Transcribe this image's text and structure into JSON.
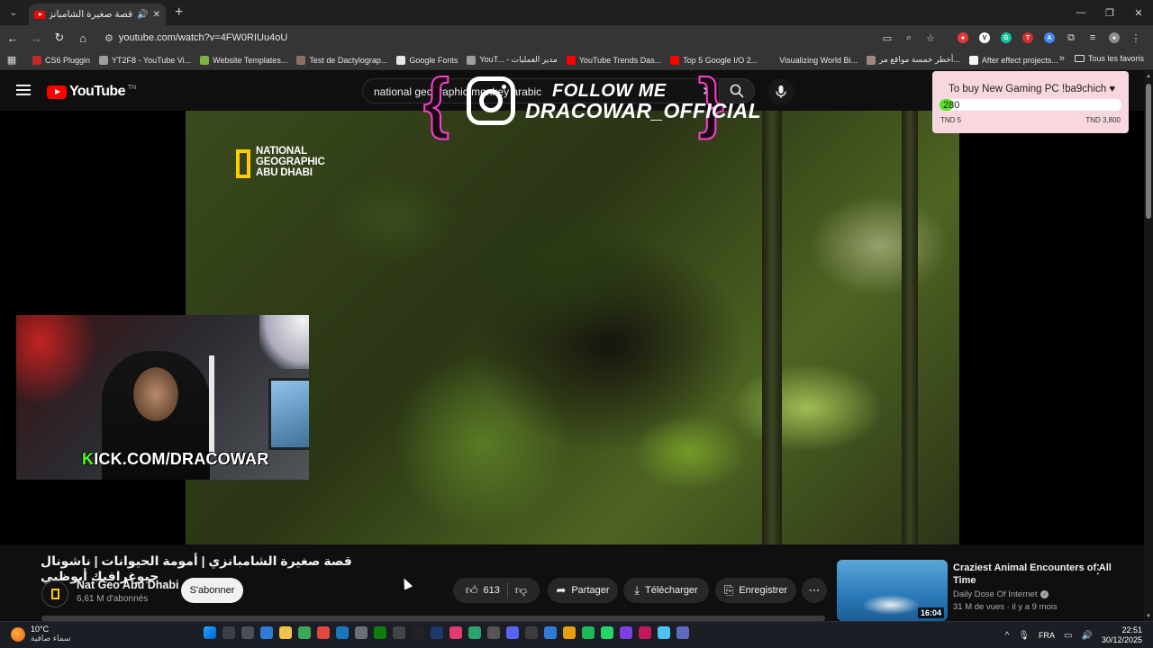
{
  "browser": {
    "tab_title": "قصة صغيرة الشامبانزي | أمو",
    "url": "youtube.com/watch?v=4FW0RIUu4oU",
    "bookmarks": [
      {
        "label": "CS6 Pluggin",
        "color": "#c62828"
      },
      {
        "label": "YT2F8 - YouTube Vi...",
        "color": "#9e9e9e"
      },
      {
        "label": "Website Templates...",
        "color": "#7cb342"
      },
      {
        "label": "Test de Dactylograp...",
        "color": "#8d6e63"
      },
      {
        "label": "Google Fonts",
        "color": "#e8e8e8"
      },
      {
        "label": "YouT... - مدير العمليات",
        "color": "#9e9e9e"
      },
      {
        "label": "YouTube Trends Das...",
        "color": "#ff0000"
      },
      {
        "label": "Top 5 Google I/O 2...",
        "color": "#ff0000"
      },
      {
        "label": "Visualizing World Bi...",
        "color": "#353535"
      },
      {
        "label": "أخطر خمسة مواقع مر...",
        "color": "#a1887f"
      },
      {
        "label": "After effect projects...",
        "color": "#f5f5f5"
      }
    ],
    "all_bookmarks": "Tous les favoris"
  },
  "youtube": {
    "logo_text": "YouTube",
    "logo_sup": "TN",
    "search_query": "national geographic monkey arabic",
    "video_title": "قصة صغيرة الشامبانزي | أمومة الحيوانات | ناشونال جيوغرافيك أبوظبي",
    "channel_name": "Nat Geo Abu Dhabi",
    "channel_subs": "6,61 M d'abonnés",
    "subscribe": "S'abonner",
    "likes": "613",
    "share": "Partager",
    "download": "Télécharger",
    "save": "Enregistrer",
    "video_watermark": [
      "NATIONAL",
      "GEOGRAPHIC",
      "ABU DHABI"
    ],
    "recommended": {
      "title": "Craziest Animal Encounters of All Time",
      "channel": "Daily Dose Of Internet",
      "meta": "31 M de vues · il y a 9 mois",
      "duration": "16:04"
    }
  },
  "overlay": {
    "follow": "FOLLOW ME",
    "handle": "DRACOWAR_OFFICIAL",
    "kick_prefix": "K",
    "kick_rest": "ICK.COM/DRACOWAR"
  },
  "goal": {
    "title": "To buy New Gaming PC !ba9chich ♥",
    "current": "280",
    "min_label": "TND 5",
    "max_label": "TND 3,800",
    "progress_fraction": 0.072
  },
  "taskbar": {
    "temp": "10°C",
    "weather_desc": "سماء صافية",
    "lang": "FRA",
    "time": "22:51",
    "date": "30/12/2025"
  },
  "colors": {
    "youtube_red": "#ff0000",
    "kick_green": "#53fc18",
    "instagram_pink": "#ff3fd0",
    "natgeo_yellow": "#ffcc00",
    "goal_bg": "#f8d7df"
  }
}
